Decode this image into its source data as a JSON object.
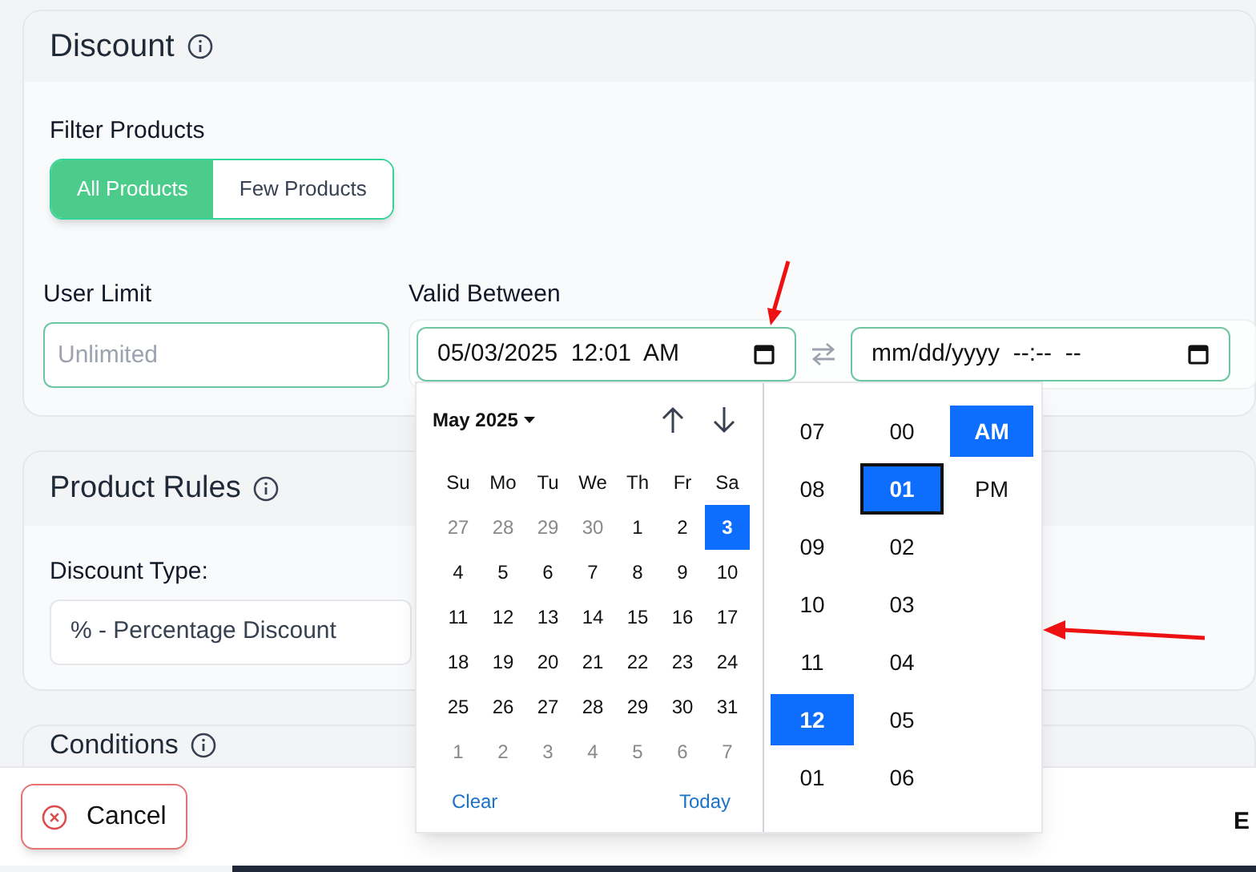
{
  "discount": {
    "title": "Discount",
    "filter_label": "Filter Products",
    "filter_options": [
      {
        "label": "All Products",
        "selected": true
      },
      {
        "label": "Few Products",
        "selected": false
      }
    ],
    "user_limit": {
      "label": "User Limit",
      "placeholder": "Unlimited"
    },
    "valid_between": {
      "label": "Valid Between",
      "start": {
        "value": "05/03/2025  12:01  AM"
      },
      "end": {
        "value": "mm/dd/yyyy  --:--  --"
      }
    }
  },
  "datepicker": {
    "month_label": "May 2025",
    "weekdays": [
      "Su",
      "Mo",
      "Tu",
      "We",
      "Th",
      "Fr",
      "Sa"
    ],
    "days": [
      {
        "label": "27",
        "outside": true,
        "selected": false
      },
      {
        "label": "28",
        "outside": true,
        "selected": false
      },
      {
        "label": "29",
        "outside": true,
        "selected": false
      },
      {
        "label": "30",
        "outside": true,
        "selected": false
      },
      {
        "label": "1",
        "outside": false,
        "selected": false
      },
      {
        "label": "2",
        "outside": false,
        "selected": false
      },
      {
        "label": "3",
        "outside": false,
        "selected": true
      },
      {
        "label": "4",
        "outside": false,
        "selected": false
      },
      {
        "label": "5",
        "outside": false,
        "selected": false
      },
      {
        "label": "6",
        "outside": false,
        "selected": false
      },
      {
        "label": "7",
        "outside": false,
        "selected": false
      },
      {
        "label": "8",
        "outside": false,
        "selected": false
      },
      {
        "label": "9",
        "outside": false,
        "selected": false
      },
      {
        "label": "10",
        "outside": false,
        "selected": false
      },
      {
        "label": "11",
        "outside": false,
        "selected": false
      },
      {
        "label": "12",
        "outside": false,
        "selected": false
      },
      {
        "label": "13",
        "outside": false,
        "selected": false
      },
      {
        "label": "14",
        "outside": false,
        "selected": false
      },
      {
        "label": "15",
        "outside": false,
        "selected": false
      },
      {
        "label": "16",
        "outside": false,
        "selected": false
      },
      {
        "label": "17",
        "outside": false,
        "selected": false
      },
      {
        "label": "18",
        "outside": false,
        "selected": false
      },
      {
        "label": "19",
        "outside": false,
        "selected": false
      },
      {
        "label": "20",
        "outside": false,
        "selected": false
      },
      {
        "label": "21",
        "outside": false,
        "selected": false
      },
      {
        "label": "22",
        "outside": false,
        "selected": false
      },
      {
        "label": "23",
        "outside": false,
        "selected": false
      },
      {
        "label": "24",
        "outside": false,
        "selected": false
      },
      {
        "label": "25",
        "outside": false,
        "selected": false
      },
      {
        "label": "26",
        "outside": false,
        "selected": false
      },
      {
        "label": "27",
        "outside": false,
        "selected": false
      },
      {
        "label": "28",
        "outside": false,
        "selected": false
      },
      {
        "label": "29",
        "outside": false,
        "selected": false
      },
      {
        "label": "30",
        "outside": false,
        "selected": false
      },
      {
        "label": "31",
        "outside": false,
        "selected": false
      },
      {
        "label": "1",
        "outside": true,
        "selected": false
      },
      {
        "label": "2",
        "outside": true,
        "selected": false
      },
      {
        "label": "3",
        "outside": true,
        "selected": false
      },
      {
        "label": "4",
        "outside": true,
        "selected": false
      },
      {
        "label": "5",
        "outside": true,
        "selected": false
      },
      {
        "label": "6",
        "outside": true,
        "selected": false
      },
      {
        "label": "7",
        "outside": true,
        "selected": false
      }
    ],
    "clear": "Clear",
    "today": "Today",
    "hours": [
      {
        "label": "07",
        "selected": false
      },
      {
        "label": "08",
        "selected": false
      },
      {
        "label": "09",
        "selected": false
      },
      {
        "label": "10",
        "selected": false
      },
      {
        "label": "11",
        "selected": false
      },
      {
        "label": "12",
        "selected": true
      },
      {
        "label": "01",
        "selected": false
      }
    ],
    "minutes": [
      {
        "label": "00",
        "selected": false
      },
      {
        "label": "01",
        "selected": true
      },
      {
        "label": "02",
        "selected": false
      },
      {
        "label": "03",
        "selected": false
      },
      {
        "label": "04",
        "selected": false
      },
      {
        "label": "05",
        "selected": false
      },
      {
        "label": "06",
        "selected": false
      }
    ],
    "periods": [
      {
        "label": "AM",
        "selected": true
      },
      {
        "label": "PM",
        "selected": false
      }
    ]
  },
  "product_rules": {
    "title": "Product Rules",
    "discount_type_label": "Discount Type:",
    "discount_type_value": "% - Percentage Discount"
  },
  "conditions": {
    "title": "Conditions"
  },
  "footer": {
    "cancel": "Cancel",
    "column_2": "E"
  }
}
